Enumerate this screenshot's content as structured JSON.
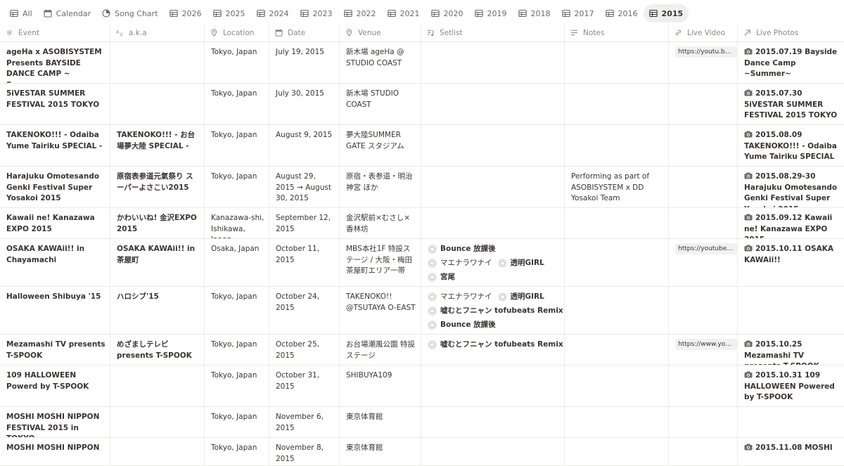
{
  "tabs": [
    {
      "label": "All",
      "icon": "table-icon"
    },
    {
      "label": "Calendar",
      "icon": "calendar-icon"
    },
    {
      "label": "Song Chart",
      "icon": "chart-icon"
    },
    {
      "label": "2026",
      "icon": "table-icon"
    },
    {
      "label": "2025",
      "icon": "table-icon"
    },
    {
      "label": "2024",
      "icon": "table-icon"
    },
    {
      "label": "2023",
      "icon": "table-icon"
    },
    {
      "label": "2022",
      "icon": "table-icon"
    },
    {
      "label": "2021",
      "icon": "table-icon"
    },
    {
      "label": "2020",
      "icon": "table-icon"
    },
    {
      "label": "2019",
      "icon": "table-icon"
    },
    {
      "label": "2018",
      "icon": "table-icon"
    },
    {
      "label": "2017",
      "icon": "table-icon"
    },
    {
      "label": "2016",
      "icon": "table-icon"
    },
    {
      "label": "2015",
      "icon": "table-icon",
      "active": true
    }
  ],
  "columns": [
    {
      "label": "Event",
      "icon": "gear-icon"
    },
    {
      "label": "a.k.a",
      "icon": "translate-icon"
    },
    {
      "label": "Location",
      "icon": "pin-icon"
    },
    {
      "label": "Date",
      "icon": "calendar-icon"
    },
    {
      "label": "Venue",
      "icon": "pin-icon"
    },
    {
      "label": "Setlist",
      "icon": "music-list-icon"
    },
    {
      "label": "Notes",
      "icon": "text-lines-icon"
    },
    {
      "label": "Live Video",
      "icon": "link-icon"
    },
    {
      "label": "Live Photos",
      "icon": "arrow-up-right-icon"
    }
  ],
  "colors": {
    "active_tab_bg": "#efefed",
    "border": "#e9e9e7",
    "text": "#37352f",
    "muted": "#8a8984"
  },
  "rows": [
    {
      "event": "ageHa x ASOBISYSTEM Presents BAYSIDE DANCE CAMP ~ Summer ~",
      "aka": "",
      "location": "Tokyo, Japan",
      "date": "July 19, 2015",
      "venue": "新木場 ageHa @ STUDIO COAST",
      "setlist": [],
      "notes": "",
      "video": "https://youtu.be/...",
      "photos": "2015.07.19 Bayside Dance Camp ~Summer~"
    },
    {
      "event": "5iVESTAR SUMMER FESTIVAL 2015 TOKYO",
      "aka": "",
      "location": "Tokyo, Japan",
      "date": "July 30, 2015",
      "venue": "新木場 STUDIO COAST",
      "setlist": [],
      "notes": "",
      "video": "",
      "photos": "2015.07.30 5iVESTAR SUMMER FESTIVAL 2015 TOKYO"
    },
    {
      "event": "TAKENOKO!!! - Odaiba Yume Tairiku SPECIAL -",
      "aka": "TAKENOKO!!! - お台場夢大陸 SPECIAL -",
      "location": "Tokyo, Japan",
      "date": "August 9, 2015",
      "venue": "夢大陸SUMMER GATE スタジアム",
      "setlist": [],
      "notes": "",
      "video": "",
      "photos": "2015.08.09 TAKENOKO!!! - Odaiba Yume Tairiku SPECIAL -"
    },
    {
      "event": "Harajuku Omotesando Genki Festival Super Yosakoi 2015",
      "aka": "原宿表参道元氣祭り スーパーよさこい2015",
      "location": "Tokyo, Japan",
      "date": "August 29, 2015 → August 30, 2015",
      "venue": "原宿・表参道・明治神宮 ほか",
      "setlist": [],
      "notes": "Performing as part of ASOBISYSTEM x DD Yosakoi Team",
      "video": "",
      "photos": "2015.08.29-30 Harajuku Omotesando Genki Festival Super Yosakoi 2015"
    },
    {
      "event": "Kawaii ne! Kanazawa EXPO 2015",
      "aka": "かわいいね! 金沢EXPO 2015",
      "location": "Kanazawa-shi, Ishikawa, Japan",
      "date": "September 12, 2015",
      "venue": "金沢駅前×むさし×香林坊",
      "setlist": [],
      "notes": "",
      "video": "",
      "photos": "2015.09.12 Kawaii ne! Kanazawa EXPO 2015"
    },
    {
      "event": "OSAKA KAWAii!! in Chayamachi",
      "aka": "OSAKA KAWAii!! in 茶屋町",
      "location": "Osaka, Japan",
      "date": "October 11, 2015",
      "venue": "MBS本社1F 特設ステージ / 大阪・梅田 茶屋町エリア一帯",
      "setlist": [
        {
          "t": "Bounce 放課後",
          "b": true
        },
        {
          "t": "マエナラワナイ",
          "b": false
        },
        {
          "t": "透明GIRL",
          "b": true
        },
        {
          "t": "宮尾",
          "b": true
        },
        {
          "t": "嘘むとフニャン tofubeats Remix",
          "b": true
        }
      ],
      "notes": "",
      "video": "https://youtube.c...",
      "photos": "2015.10.11 OSAKA KAWAii!!"
    },
    {
      "event": "Halloween Shibuya '15",
      "aka": "ハロシブ'15",
      "location": "Tokyo, Japan",
      "date": "October 24, 2015",
      "venue": "TAKENOKO!! @TSUTAYA O-EAST",
      "setlist": [
        {
          "t": "マエナラワナイ",
          "b": false
        },
        {
          "t": "透明GIRL",
          "b": true
        },
        {
          "t": "嘘むとフニャン tofubeats Remix",
          "b": true
        },
        {
          "t": "Bounce 放課後",
          "b": true
        }
      ],
      "notes": "",
      "video": "",
      "photos": ""
    },
    {
      "event": "Mezamashi TV presents T-SPOOK",
      "aka": "めざましテレビ presents T-SPOOK",
      "location": "Tokyo, Japan",
      "date": "October 25, 2015",
      "venue": "お台場潮風公園 特設ステージ",
      "setlist": [
        {
          "t": "嘘むとフニャン tofubeats Remix",
          "b": true
        }
      ],
      "notes": "",
      "video": "https://www.yout...",
      "photos": "2015.10.25 Mezamashi TV presents T-SPOOK"
    },
    {
      "event": "109 HALLOWEEN Powerd by T-SPOOK",
      "aka": "",
      "location": "Tokyo, Japan",
      "date": "October 31, 2015",
      "venue": "SHIBUYA109",
      "setlist": [],
      "notes": "",
      "video": "",
      "photos": "2015.10.31 109 HALLOWEEN Powered by T-SPOOK"
    },
    {
      "event": "MOSHI MOSHI NIPPON FESTIVAL 2015 in TOKYO",
      "aka": "",
      "location": "Tokyo, Japan",
      "date": "November 6, 2015",
      "venue": "東京体育館",
      "setlist": [],
      "notes": "",
      "video": "",
      "photos": ""
    },
    {
      "event": "MOSHI MOSHI NIPPON",
      "aka": "",
      "location": "Tokyo, Japan",
      "date": "November 8, 2015",
      "venue": "東京体育館",
      "setlist": [],
      "notes": "",
      "video": "",
      "photos": "2015.11.08 MOSHI"
    }
  ]
}
